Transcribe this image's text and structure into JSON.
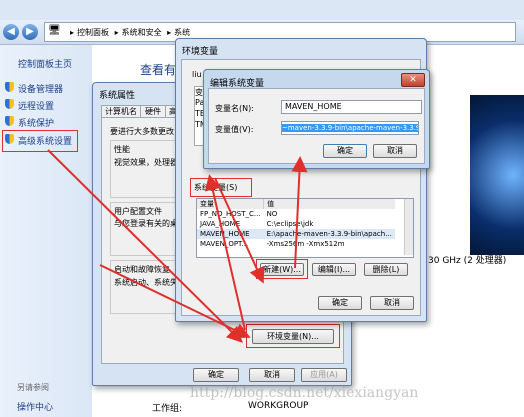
{
  "explorer": {
    "breadcrumb": [
      "控制面板",
      "系统和安全",
      "系统"
    ],
    "heading_partial": "查看有关",
    "cpu_text": "30 GHz (2 处理器)",
    "workgroup_label": "工作组:",
    "workgroup_value": "WORKGROUP",
    "sidebar": {
      "home": "控制面板主页",
      "items": [
        {
          "label": "设备管理器"
        },
        {
          "label": "远程设置"
        },
        {
          "label": "系统保护"
        },
        {
          "label": "高级系统设置"
        }
      ],
      "see_also": "另请参阅",
      "action_center": "操作中心"
    }
  },
  "sysprops": {
    "title": "系统属性",
    "tabs": [
      "计算机名",
      "硬件",
      "高"
    ],
    "admin_note": "要进行大多数更改",
    "perf_title": "性能",
    "perf_text": "视觉效果，处理器",
    "profile_title": "用户配置文件",
    "profile_text": "与您登录有关的桌",
    "startup_title": "启动和故障恢复",
    "startup_text": "系统启动、系统失",
    "env_button": "环境变量(N)...",
    "ok": "确定",
    "cancel": "取消",
    "apply": "应用(A)"
  },
  "envvars": {
    "title": "环境变量",
    "user_header_partial": "liu",
    "left_partial": [
      "变",
      "Pa",
      "TE",
      "TM"
    ],
    "system_group": "系统变量(S)",
    "columns": [
      "变量",
      "值"
    ],
    "rows": [
      {
        "name": "FP_NO_HOST_C...",
        "value": "NO"
      },
      {
        "name": "JAVA_HOME",
        "value": "C:\\eclipse\\jdk"
      },
      {
        "name": "MAVEN_HOME",
        "value": "E:\\apache-maven-3.3.9-bin\\apach..."
      },
      {
        "name": "MAVEN_OPT...",
        "value": "-Xms256m -Xmx512m"
      }
    ],
    "new_button": "新建(W)...",
    "edit_button": "编辑(I)...",
    "delete_button": "删除(L)",
    "ok": "确定",
    "cancel": "取消"
  },
  "editvar": {
    "title": "编辑系统变量",
    "name_label": "变量名(N):",
    "name_value": "MAVEN_HOME",
    "value_label": "变量值(V):",
    "value_value": "~maven-3.3.9-bin\\apache-maven-3.3.9",
    "ok": "确定",
    "cancel": "取消"
  },
  "watermark": "http://blog.csdn.net/xiexiangyan",
  "colors": {
    "annotation_red": "#e0302c",
    "link_blue": "#1e3f8a"
  }
}
